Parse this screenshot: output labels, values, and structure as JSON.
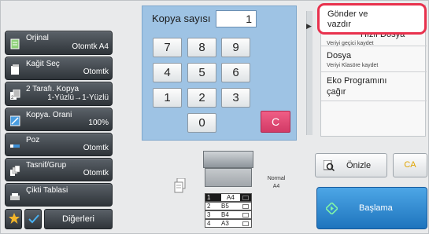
{
  "sidebar": {
    "items": [
      {
        "label": "Orjinal",
        "value": "Otomtk  A4"
      },
      {
        "label": "Kağit Seç",
        "value": "Otomtk"
      },
      {
        "label": "2 Tarafı. Kopya",
        "value": "1-Yüzlü→1-Yüzlü"
      },
      {
        "label": "Kopya. Orani",
        "value": "100%"
      },
      {
        "label": "Poz",
        "value": "Otomtk"
      },
      {
        "label": "Tasnif/Grup",
        "value": "Otomtk"
      },
      {
        "label": "Çikti Tablasi",
        "value": ""
      }
    ],
    "others_label": "Diğerleri"
  },
  "keypad": {
    "title": "Kopya sayısı",
    "value": "1",
    "keys": [
      "7",
      "8",
      "9",
      "4",
      "5",
      "6",
      "1",
      "2",
      "3",
      "0"
    ],
    "clear_label": "C",
    "clear_color": "#e0457a"
  },
  "right_panel": {
    "highlight_color": "#e8314d",
    "send_print": {
      "line1": "Gönder ve",
      "line2": "vazdır"
    },
    "hidden_item": {
      "main": "Hızlı Dosya",
      "sub": "Veriyi geçici kaydet"
    },
    "file": {
      "main": "Dosya",
      "sub": "Veriyi Klasöre kaydet"
    },
    "eco": {
      "line1": "Eko Programını",
      "line2": "çağır"
    }
  },
  "preview_label": "Önizle",
  "ca_label": "CA",
  "start_label": "Başlama",
  "machine": {
    "status_line1": "Normal",
    "status_line2": "A4",
    "trays": [
      {
        "num": "1",
        "paper": "A4",
        "selected": true
      },
      {
        "num": "2",
        "paper": "B5",
        "selected": false
      },
      {
        "num": "3",
        "paper": "B4",
        "selected": false
      },
      {
        "num": "4",
        "paper": "A3",
        "selected": false
      }
    ]
  },
  "icons": [
    "original-icon",
    "paper-select-icon",
    "duplex-icon",
    "zoom-icon",
    "exposure-icon",
    "sort-icon",
    "output-tray-icon",
    "star-icon",
    "check-icon",
    "preview-icon",
    "start-icon",
    "document-icon"
  ],
  "colors": {
    "accent_blue": "#1e74bd",
    "keypad_bg": "#9ec3e4",
    "ca_text": "#e0a400"
  }
}
